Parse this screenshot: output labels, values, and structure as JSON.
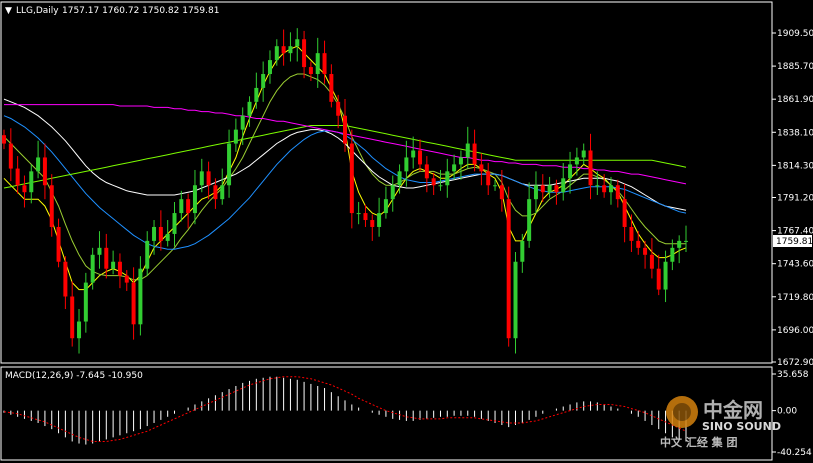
{
  "header": {
    "arrow": "▼",
    "symbol_tf": "LLG,Daily",
    "ohlc": "1757.17 1760.72 1750.82 1759.81"
  },
  "price_axis": {
    "ticks": [
      "1909.50",
      "1885.70",
      "1861.90",
      "1838.10",
      "1814.30",
      "1791.20",
      "1767.40",
      "1743.60",
      "1719.80",
      "1696.00",
      "1672.90"
    ],
    "current": "1759.81"
  },
  "macd": {
    "label": "MACD(12,26,9) -7.645 -10.950",
    "ticks": [
      "35.658",
      "0.00",
      "-40.254"
    ]
  },
  "watermark": {
    "cn": "中金网",
    "en": "SINO SOUND",
    "sub": "中文 汇经 集 团"
  },
  "colors": {
    "background": "#000000",
    "bull": "#32cd32",
    "bear": "#ff0000",
    "axis": "#ffffff",
    "ma_fast": "#ffff00",
    "ma_5": "#9acd32",
    "ma_10": "#ffffff",
    "ma_20": "#1e90ff",
    "ma_60": "#7cfc00",
    "ma_120": "#ff00ff",
    "macd_hist": "#ffffff",
    "macd_signal": "#ff0000"
  },
  "chart_data": {
    "type": "candlestick",
    "instrument": "LLG",
    "timeframe": "Daily",
    "last_bar": {
      "open": 1757.17,
      "high": 1760.72,
      "low": 1750.82,
      "close": 1759.81
    },
    "price_range": [
      1672.9,
      1909.5
    ],
    "macd_range": [
      -40.254,
      35.658
    ],
    "close_path": [
      1830,
      1812,
      1800,
      1795,
      1810,
      1820,
      1800,
      1770,
      1745,
      1720,
      1690,
      1702,
      1730,
      1750,
      1755,
      1740,
      1745,
      1735,
      1730,
      1700,
      1740,
      1760,
      1770,
      1760,
      1765,
      1780,
      1790,
      1780,
      1800,
      1810,
      1800,
      1790,
      1800,
      1830,
      1840,
      1850,
      1860,
      1870,
      1880,
      1890,
      1900,
      1895,
      1900,
      1905,
      1885,
      1880,
      1895,
      1880,
      1860,
      1850,
      1830,
      1780,
      1780,
      1775,
      1770,
      1780,
      1790,
      1800,
      1810,
      1820,
      1825,
      1815,
      1805,
      1800,
      1800,
      1810,
      1815,
      1820,
      1830,
      1815,
      1810,
      1800,
      1800,
      1790,
      1690,
      1745,
      1760,
      1790,
      1800,
      1795,
      1800,
      1795,
      1805,
      1815,
      1820,
      1825,
      1800,
      1800,
      1795,
      1800,
      1790,
      1770,
      1760,
      1755,
      1750,
      1740,
      1725,
      1745,
      1755,
      1760,
      1760
    ],
    "series": [
      {
        "name": "MA fast",
        "color": "#ffff00",
        "values": [
          1805,
          1800,
          1795,
          1790,
          1790,
          1790,
          1785,
          1775,
          1760,
          1745,
          1730,
          1725,
          1725,
          1730,
          1735,
          1738,
          1740,
          1738,
          1735,
          1730,
          1735,
          1745,
          1755,
          1760,
          1765,
          1770,
          1775,
          1780,
          1785,
          1790,
          1792,
          1795,
          1800,
          1810,
          1820,
          1835,
          1848,
          1860,
          1872,
          1882,
          1890,
          1895,
          1898,
          1900,
          1895,
          1890,
          1885,
          1880,
          1870,
          1860,
          1840,
          1810,
          1795,
          1785,
          1780,
          1778,
          1782,
          1790,
          1798,
          1805,
          1810,
          1812,
          1810,
          1808,
          1805,
          1805,
          1808,
          1812,
          1815,
          1815,
          1812,
          1808,
          1805,
          1795,
          1770,
          1760,
          1760,
          1770,
          1780,
          1790,
          1795,
          1797,
          1800,
          1805,
          1810,
          1815,
          1812,
          1808,
          1805,
          1800,
          1795,
          1785,
          1775,
          1765,
          1758,
          1752,
          1748,
          1748,
          1750,
          1753,
          1755
        ]
      },
      {
        "name": "MA 5",
        "color": "#9acd32",
        "values": [
          1835,
          1830,
          1825,
          1820,
          1815,
          1810,
          1805,
          1795,
          1785,
          1772,
          1760,
          1750,
          1742,
          1738,
          1736,
          1735,
          1735,
          1735,
          1734,
          1732,
          1732,
          1735,
          1740,
          1745,
          1750,
          1755,
          1762,
          1768,
          1775,
          1782,
          1788,
          1793,
          1798,
          1805,
          1812,
          1820,
          1830,
          1840,
          1850,
          1860,
          1868,
          1874,
          1878,
          1880,
          1880,
          1878,
          1876,
          1872,
          1866,
          1858,
          1848,
          1835,
          1825,
          1815,
          1808,
          1803,
          1800,
          1800,
          1802,
          1805,
          1808,
          1810,
          1810,
          1810,
          1808,
          1808,
          1808,
          1810,
          1812,
          1813,
          1812,
          1810,
          1808,
          1802,
          1790,
          1782,
          1778,
          1778,
          1780,
          1785,
          1790,
          1793,
          1796,
          1800,
          1804,
          1808,
          1808,
          1806,
          1804,
          1800,
          1796,
          1790,
          1783,
          1776,
          1770,
          1765,
          1760,
          1758,
          1758,
          1758,
          1758
        ]
      },
      {
        "name": "MA 10",
        "color": "#ffffff",
        "values": [
          1862,
          1860,
          1858,
          1856,
          1853,
          1850,
          1846,
          1842,
          1837,
          1832,
          1826,
          1820,
          1814,
          1809,
          1805,
          1802,
          1800,
          1798,
          1796,
          1795,
          1794,
          1793,
          1793,
          1793,
          1793,
          1793,
          1794,
          1795,
          1796,
          1798,
          1800,
          1802,
          1804,
          1806,
          1808,
          1811,
          1814,
          1818,
          1822,
          1826,
          1830,
          1833,
          1836,
          1838,
          1839,
          1840,
          1840,
          1839,
          1837,
          1834,
          1830,
          1825,
          1820,
          1815,
          1810,
          1806,
          1803,
          1800,
          1799,
          1798,
          1798,
          1799,
          1800,
          1801,
          1802,
          1803,
          1804,
          1805,
          1806,
          1807,
          1808,
          1808,
          1808,
          1807,
          1805,
          1803,
          1801,
          1800,
          1800,
          1800,
          1800,
          1801,
          1802,
          1803,
          1804,
          1805,
          1805,
          1805,
          1805,
          1804,
          1803,
          1801,
          1799,
          1796,
          1793,
          1790,
          1787,
          1785,
          1784,
          1783,
          1782
        ]
      },
      {
        "name": "MA 20",
        "color": "#1e90ff",
        "values": [
          1850,
          1848,
          1845,
          1842,
          1838,
          1834,
          1829,
          1824,
          1818,
          1812,
          1806,
          1800,
          1794,
          1789,
          1784,
          1780,
          1776,
          1772,
          1768,
          1764,
          1761,
          1758,
          1756,
          1755,
          1754,
          1754,
          1755,
          1756,
          1758,
          1761,
          1764,
          1768,
          1772,
          1776,
          1781,
          1786,
          1791,
          1797,
          1803,
          1809,
          1815,
          1820,
          1825,
          1829,
          1833,
          1836,
          1838,
          1839,
          1839,
          1838,
          1836,
          1833,
          1829,
          1825,
          1820,
          1816,
          1812,
          1809,
          1806,
          1804,
          1803,
          1802,
          1802,
          1802,
          1803,
          1804,
          1805,
          1806,
          1807,
          1808,
          1808,
          1808,
          1808,
          1807,
          1805,
          1803,
          1801,
          1799,
          1797,
          1796,
          1795,
          1795,
          1795,
          1796,
          1797,
          1798,
          1799,
          1799,
          1799,
          1799,
          1798,
          1797,
          1795,
          1793,
          1791,
          1789,
          1787,
          1785,
          1783,
          1781,
          1780
        ]
      },
      {
        "name": "MA 60",
        "color": "#7cfc00",
        "values": [
          1798,
          1799,
          1800,
          1801,
          1802,
          1803,
          1804,
          1805,
          1806,
          1807,
          1808,
          1809,
          1810,
          1811,
          1812,
          1813,
          1814,
          1815,
          1816,
          1817,
          1818,
          1819,
          1820,
          1821,
          1822,
          1823,
          1824,
          1825,
          1826,
          1827,
          1828,
          1829,
          1830,
          1831,
          1832,
          1833,
          1834,
          1835,
          1836,
          1837,
          1838,
          1839,
          1840,
          1841,
          1842,
          1843,
          1843,
          1843,
          1843,
          1843,
          1843,
          1842,
          1841,
          1840,
          1839,
          1838,
          1837,
          1836,
          1835,
          1834,
          1833,
          1832,
          1831,
          1830,
          1829,
          1828,
          1827,
          1826,
          1825,
          1824,
          1823,
          1822,
          1821,
          1820,
          1819,
          1818,
          1818,
          1818,
          1818,
          1818,
          1818,
          1818,
          1818,
          1818,
          1818,
          1818,
          1818,
          1818,
          1818,
          1818,
          1818,
          1818,
          1818,
          1818,
          1818,
          1818,
          1817,
          1816,
          1815,
          1814,
          1813
        ]
      },
      {
        "name": "MA 120",
        "color": "#ff00ff",
        "values": [
          1858,
          1858,
          1858,
          1858,
          1858,
          1858,
          1858,
          1858,
          1858,
          1858,
          1858,
          1858,
          1858,
          1858,
          1858,
          1858,
          1858,
          1857,
          1857,
          1857,
          1857,
          1857,
          1856,
          1856,
          1856,
          1855,
          1855,
          1854,
          1854,
          1853,
          1853,
          1852,
          1852,
          1851,
          1850,
          1850,
          1849,
          1848,
          1848,
          1847,
          1846,
          1846,
          1845,
          1844,
          1843,
          1842,
          1841,
          1840,
          1839,
          1838,
          1837,
          1836,
          1835,
          1834,
          1833,
          1832,
          1831,
          1830,
          1829,
          1828,
          1827,
          1826,
          1825,
          1824,
          1823,
          1822,
          1821,
          1820,
          1820,
          1819,
          1818,
          1818,
          1817,
          1817,
          1816,
          1816,
          1815,
          1815,
          1815,
          1814,
          1814,
          1814,
          1813,
          1813,
          1813,
          1812,
          1812,
          1811,
          1811,
          1810,
          1810,
          1809,
          1808,
          1808,
          1807,
          1806,
          1805,
          1804,
          1803,
          1802,
          1801
        ]
      }
    ],
    "macd_hist": [
      -2,
      -4,
      -6,
      -8,
      -10,
      -12,
      -15,
      -18,
      -22,
      -26,
      -30,
      -32,
      -33,
      -32,
      -30,
      -28,
      -26,
      -24,
      -22,
      -20,
      -18,
      -15,
      -12,
      -9,
      -6,
      -3,
      0,
      3,
      6,
      9,
      12,
      15,
      18,
      21,
      24,
      27,
      29,
      31,
      32,
      33,
      33,
      32,
      31,
      30,
      28,
      26,
      24,
      22,
      18,
      14,
      10,
      6,
      3,
      0,
      -2,
      -4,
      -6,
      -8,
      -9,
      -10,
      -10,
      -9,
      -8,
      -7,
      -6,
      -6,
      -5,
      -5,
      -5,
      -6,
      -8,
      -10,
      -12,
      -14,
      -16,
      -14,
      -12,
      -9,
      -6,
      -3,
      0,
      2,
      4,
      6,
      8,
      9,
      9,
      8,
      6,
      4,
      2,
      0,
      -3,
      -6,
      -10,
      -14,
      -18,
      -22,
      -26,
      -28,
      -30
    ],
    "macd_signal": [
      -1,
      -2,
      -3,
      -5,
      -7,
      -9,
      -11,
      -14,
      -17,
      -20,
      -23,
      -26,
      -28,
      -30,
      -30,
      -30,
      -29,
      -28,
      -26,
      -24,
      -22,
      -20,
      -17,
      -14,
      -11,
      -8,
      -5,
      -2,
      1,
      4,
      7,
      10,
      13,
      16,
      19,
      22,
      25,
      27,
      29,
      31,
      32,
      33,
      33,
      33,
      32,
      31,
      29,
      27,
      25,
      22,
      19,
      16,
      12,
      9,
      6,
      3,
      0,
      -2,
      -4,
      -6,
      -7,
      -8,
      -8,
      -8,
      -8,
      -7,
      -7,
      -7,
      -7,
      -7,
      -8,
      -9,
      -10,
      -11,
      -12,
      -12,
      -12,
      -11,
      -10,
      -8,
      -6,
      -4,
      -2,
      0,
      2,
      4,
      5,
      6,
      6,
      6,
      5,
      4,
      2,
      0,
      -2,
      -5,
      -8,
      -11,
      -14,
      -17,
      -20
    ]
  }
}
